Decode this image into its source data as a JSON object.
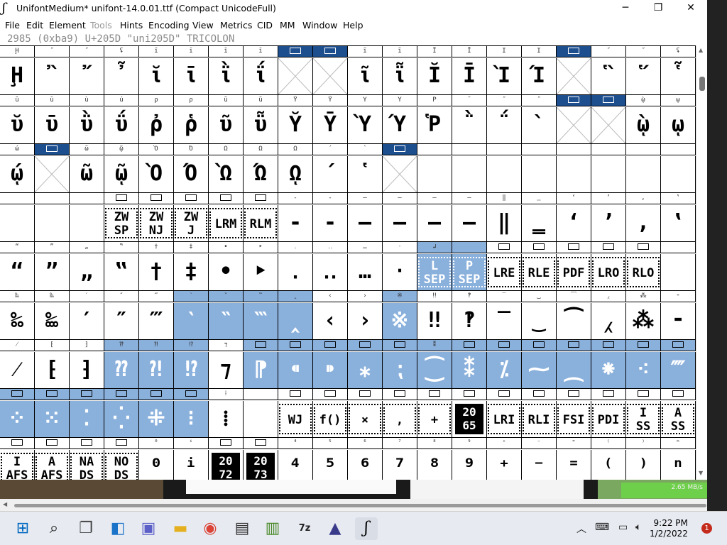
{
  "window": {
    "title": "UnifontMedium*  unifont-14.0.01.ttf (Compact UnicodeFull)",
    "minimize": "─",
    "maximize": "❐",
    "close": "✕"
  },
  "menu": [
    "File",
    "Edit",
    "Element",
    "Tools",
    "Hints",
    "Encoding",
    "View",
    "Metrics",
    "CID",
    "MM",
    "Window",
    "Help"
  ],
  "info": "2985 (0xba9) U+205D \"uni205D\" TRICOLON",
  "grid": {
    "rows": [
      {
        "labels": [
          "Ḩ",
          "˝",
          "˝",
          "ʢ",
          "ĩ",
          "ī",
          "ĭ",
          "ĭ",
          "▢",
          "▢",
          "ĩ",
          "ĩ",
          "Ï",
          "Ī",
          "I",
          "I",
          "▢",
          "˝",
          "˝",
          "ʢ"
        ],
        "glyphs": [
          "Ḩ",
          "῍",
          "῎",
          "῏",
          "ῐ",
          "ῑ",
          "ῒ",
          "ΐ",
          "",
          "",
          "ῖ",
          "ῗ",
          "Ῐ",
          "Ῑ",
          "Ὶ",
          "Ί",
          "",
          "῝",
          "῞",
          "῟"
        ]
      },
      {
        "labels": [
          "ŭ",
          "ū",
          "ù",
          "ú",
          "ρ",
          "ρ",
          "ũ",
          "ũ",
          "Ÿ",
          "Ÿ",
          "Y",
          "Y",
          "P",
          "˜",
          "˝",
          "˝",
          "▢",
          "▢",
          "ῲ",
          "ῳ"
        ],
        "glyphs": [
          "ῠ",
          "ῡ",
          "ῢ",
          "ΰ",
          "ῤ",
          "ῥ",
          "ῦ",
          "ῧ",
          "Ῠ",
          "Ῡ",
          "Ὺ",
          "Ύ",
          "Ῥ",
          "῭",
          "΅",
          "`",
          "",
          "",
          "ῲ",
          "ῳ"
        ]
      },
      {
        "labels": [
          "ώ",
          "▢",
          "ῶ",
          "ῷ",
          "Ὸ",
          "Ό",
          "Ω",
          "Ω",
          "Ω",
          "´",
          "῾",
          "▢",
          "",
          "",
          "",
          "",
          "",
          "",
          "",
          ""
        ],
        "glyphs": [
          "ῴ",
          "",
          "ῶ",
          "ῷ",
          "Ὸ",
          "Ό",
          "Ὼ",
          "Ώ",
          "ῼ",
          "´",
          "῾",
          "",
          "",
          "",
          "",
          "",
          "",
          "",
          "",
          ""
        ]
      },
      {
        "labels": [
          "",
          "",
          "",
          "▢",
          "▢",
          "▢",
          "▢",
          "▢",
          "‐",
          "‑",
          "‒",
          "–",
          "—",
          "―",
          "‖",
          "‗",
          "‘",
          "’",
          "‚",
          "‛"
        ],
        "glyphs": [
          "",
          "",
          "",
          "ZW\nSP",
          "ZW\nNJ",
          "ZW\nJ",
          "LRM",
          "RLM",
          "‐",
          "‑",
          "‒",
          "–",
          "—",
          "―",
          "‖",
          "‗",
          "‘",
          "’",
          "‚",
          "‛"
        ]
      },
      {
        "labels": [
          "“",
          "”",
          "„",
          "‟",
          "†",
          "‡",
          "•",
          "‣",
          "․",
          "‥",
          "…",
          "‧",
          "↲",
          "",
          "▢",
          "▢",
          "▢",
          "▢",
          "▢",
          ""
        ],
        "glyphs": [
          "“",
          "”",
          "„",
          "‟",
          "†",
          "‡",
          "•",
          "‣",
          "․",
          "‥",
          "…",
          "‧",
          "L\nSEP",
          "P\nSEP",
          "LRE",
          "RLE",
          "PDF",
          "LRO",
          "RLO",
          ""
        ]
      },
      {
        "labels": [
          "‰",
          "‱",
          "′",
          "″",
          "‴",
          "‵",
          "‶",
          "‷",
          "‸",
          "‹",
          "›",
          "※",
          "‼",
          "‽",
          "‾",
          "‿",
          "⁀",
          "⁁",
          "⁂",
          "⁃"
        ],
        "glyphs": [
          "‰",
          "‱",
          "′",
          "″",
          "‴",
          "‵",
          "‶",
          "‷",
          "‸",
          "‹",
          "›",
          "※",
          "‼",
          "‽",
          "‾",
          "‿",
          "⁀",
          "⁁",
          "⁂",
          "⁃"
        ]
      },
      {
        "labels": [
          "⁄",
          "⁅",
          "⁆",
          "⁇",
          "⁈",
          "⁉",
          "⁊",
          "▢",
          "▢",
          "▢",
          "▢",
          "▢",
          "⁑",
          "▢",
          "▢",
          "▢",
          "▢",
          "▢",
          "▢",
          "▢"
        ],
        "glyphs": [
          "⁄",
          "⁅",
          "⁆",
          "⁇",
          "⁈",
          "⁉",
          "⁊",
          "⁋",
          "⁌",
          "⁍",
          "⁎",
          "⁏",
          "⁐",
          "⁑",
          "⁒",
          "⁓",
          "⁔",
          "⁕",
          "⁖",
          "⁗"
        ]
      },
      {
        "labels": [
          "▢",
          "▢",
          "▢",
          "▢",
          "▢",
          "▢",
          "⁞",
          "",
          "▢",
          "▢",
          "▢",
          "▢",
          "▢",
          "▢",
          "▢",
          "▢",
          "▢",
          "▢",
          "▢",
          "▢"
        ],
        "glyphs": [
          "⁘",
          "⁙",
          "⁚",
          "⁛",
          "⁜",
          "⁝",
          "⁞",
          " ",
          "WJ",
          "f()",
          "×",
          ",",
          "+",
          "20\n65",
          "LRI",
          "RLI",
          "FSI",
          "PDI",
          "I\nSS",
          "A\nSS"
        ]
      },
      {
        "labels": [
          "▢",
          "▢",
          "▢",
          "▢",
          "⁰",
          "ⁱ",
          "▢",
          "▢",
          "⁴",
          "⁵",
          "⁶",
          "⁷",
          "⁸",
          "⁹",
          "⁺",
          "⁻",
          "⁼",
          "⁽",
          "⁾",
          "ⁿ"
        ],
        "glyphs": [
          "I\nAFS",
          "A\nAFS",
          "NA\nDS",
          "NO\nDS",
          "⁰",
          "ⁱ",
          "20\n72",
          "20\n73",
          "⁴",
          "⁵",
          "⁶",
          "⁷",
          "⁸",
          "⁹",
          "⁺",
          "⁻",
          "⁼",
          "⁽",
          "⁾",
          "ⁿ"
        ]
      }
    ]
  },
  "taskbar": {
    "time": "9:22 PM",
    "date": "1/2/2022",
    "notifications": "1",
    "net_speed": "2.65 MB/s",
    "icons": [
      "windows-start-icon",
      "search-icon",
      "task-view-icon",
      "widgets-icon",
      "chat-icon",
      "file-explorer-icon",
      "chrome-icon",
      "store-icon",
      "archive-icon",
      "7zip-icon",
      "inkscape-icon",
      "fontforge-icon"
    ]
  }
}
